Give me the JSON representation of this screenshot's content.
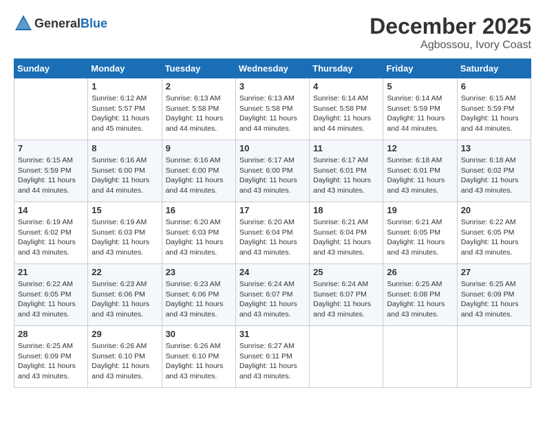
{
  "header": {
    "logo_general": "General",
    "logo_blue": "Blue",
    "month": "December 2025",
    "location": "Agbossou, Ivory Coast"
  },
  "days_of_week": [
    "Sunday",
    "Monday",
    "Tuesday",
    "Wednesday",
    "Thursday",
    "Friday",
    "Saturday"
  ],
  "weeks": [
    [
      {
        "day": "",
        "info": ""
      },
      {
        "day": "1",
        "info": "Sunrise: 6:12 AM\nSunset: 5:57 PM\nDaylight: 11 hours and 45 minutes."
      },
      {
        "day": "2",
        "info": "Sunrise: 6:13 AM\nSunset: 5:58 PM\nDaylight: 11 hours and 44 minutes."
      },
      {
        "day": "3",
        "info": "Sunrise: 6:13 AM\nSunset: 5:58 PM\nDaylight: 11 hours and 44 minutes."
      },
      {
        "day": "4",
        "info": "Sunrise: 6:14 AM\nSunset: 5:58 PM\nDaylight: 11 hours and 44 minutes."
      },
      {
        "day": "5",
        "info": "Sunrise: 6:14 AM\nSunset: 5:59 PM\nDaylight: 11 hours and 44 minutes."
      },
      {
        "day": "6",
        "info": "Sunrise: 6:15 AM\nSunset: 5:59 PM\nDaylight: 11 hours and 44 minutes."
      }
    ],
    [
      {
        "day": "7",
        "info": "Sunrise: 6:15 AM\nSunset: 5:59 PM\nDaylight: 11 hours and 44 minutes."
      },
      {
        "day": "8",
        "info": "Sunrise: 6:16 AM\nSunset: 6:00 PM\nDaylight: 11 hours and 44 minutes."
      },
      {
        "day": "9",
        "info": "Sunrise: 6:16 AM\nSunset: 6:00 PM\nDaylight: 11 hours and 44 minutes."
      },
      {
        "day": "10",
        "info": "Sunrise: 6:17 AM\nSunset: 6:00 PM\nDaylight: 11 hours and 43 minutes."
      },
      {
        "day": "11",
        "info": "Sunrise: 6:17 AM\nSunset: 6:01 PM\nDaylight: 11 hours and 43 minutes."
      },
      {
        "day": "12",
        "info": "Sunrise: 6:18 AM\nSunset: 6:01 PM\nDaylight: 11 hours and 43 minutes."
      },
      {
        "day": "13",
        "info": "Sunrise: 6:18 AM\nSunset: 6:02 PM\nDaylight: 11 hours and 43 minutes."
      }
    ],
    [
      {
        "day": "14",
        "info": "Sunrise: 6:19 AM\nSunset: 6:02 PM\nDaylight: 11 hours and 43 minutes."
      },
      {
        "day": "15",
        "info": "Sunrise: 6:19 AM\nSunset: 6:03 PM\nDaylight: 11 hours and 43 minutes."
      },
      {
        "day": "16",
        "info": "Sunrise: 6:20 AM\nSunset: 6:03 PM\nDaylight: 11 hours and 43 minutes."
      },
      {
        "day": "17",
        "info": "Sunrise: 6:20 AM\nSunset: 6:04 PM\nDaylight: 11 hours and 43 minutes."
      },
      {
        "day": "18",
        "info": "Sunrise: 6:21 AM\nSunset: 6:04 PM\nDaylight: 11 hours and 43 minutes."
      },
      {
        "day": "19",
        "info": "Sunrise: 6:21 AM\nSunset: 6:05 PM\nDaylight: 11 hours and 43 minutes."
      },
      {
        "day": "20",
        "info": "Sunrise: 6:22 AM\nSunset: 6:05 PM\nDaylight: 11 hours and 43 minutes."
      }
    ],
    [
      {
        "day": "21",
        "info": "Sunrise: 6:22 AM\nSunset: 6:05 PM\nDaylight: 11 hours and 43 minutes."
      },
      {
        "day": "22",
        "info": "Sunrise: 6:23 AM\nSunset: 6:06 PM\nDaylight: 11 hours and 43 minutes."
      },
      {
        "day": "23",
        "info": "Sunrise: 6:23 AM\nSunset: 6:06 PM\nDaylight: 11 hours and 43 minutes."
      },
      {
        "day": "24",
        "info": "Sunrise: 6:24 AM\nSunset: 6:07 PM\nDaylight: 11 hours and 43 minutes."
      },
      {
        "day": "25",
        "info": "Sunrise: 6:24 AM\nSunset: 6:07 PM\nDaylight: 11 hours and 43 minutes."
      },
      {
        "day": "26",
        "info": "Sunrise: 6:25 AM\nSunset: 6:08 PM\nDaylight: 11 hours and 43 minutes."
      },
      {
        "day": "27",
        "info": "Sunrise: 6:25 AM\nSunset: 6:09 PM\nDaylight: 11 hours and 43 minutes."
      }
    ],
    [
      {
        "day": "28",
        "info": "Sunrise: 6:25 AM\nSunset: 6:09 PM\nDaylight: 11 hours and 43 minutes."
      },
      {
        "day": "29",
        "info": "Sunrise: 6:26 AM\nSunset: 6:10 PM\nDaylight: 11 hours and 43 minutes."
      },
      {
        "day": "30",
        "info": "Sunrise: 6:26 AM\nSunset: 6:10 PM\nDaylight: 11 hours and 43 minutes."
      },
      {
        "day": "31",
        "info": "Sunrise: 6:27 AM\nSunset: 6:11 PM\nDaylight: 11 hours and 43 minutes."
      },
      {
        "day": "",
        "info": ""
      },
      {
        "day": "",
        "info": ""
      },
      {
        "day": "",
        "info": ""
      }
    ]
  ]
}
